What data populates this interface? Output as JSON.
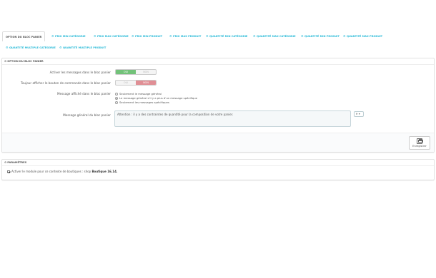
{
  "tabs": [
    {
      "label": "OPTION DU BLOC PANIER",
      "active": true
    },
    {
      "label": "PRIX MIN CATÉGORIE"
    },
    {
      "label": "PRIX MAX CATÉGORIE"
    },
    {
      "label": "PRIX MIN PRODUIT"
    },
    {
      "label": "PRIX MAX PRODUIT"
    },
    {
      "label": "QUANTITÉ MIN CATÉGORIE"
    },
    {
      "label": "QUANTITÉ MAX CATÉGORIE"
    },
    {
      "label": "QUANTITÉ MIN PRODUIT"
    },
    {
      "label": "QUANTITÉ MAX PRODUIT"
    },
    {
      "label": "QUANTITÉ MULTIPLE CATÉGORIE"
    },
    {
      "label": "QUANTITÉ MULTIPLE PRODUIT"
    }
  ],
  "panel_bloc": {
    "title": "OPTION DU BLOC PANIER",
    "field_messages": {
      "label": "Activer les messages dans le bloc panier",
      "yes": "OUI",
      "no": "NON",
      "value": "yes"
    },
    "field_order_button": {
      "label": "Toujour afficher le bouton de commande dans le bloc panier",
      "yes": "OUI",
      "no": "NON",
      "value": "no"
    },
    "field_message_type": {
      "label": "Message affiché dans le bloc panier",
      "options": [
        {
          "label": "Seulement le message général",
          "checked": false
        },
        {
          "label": "Le message général s'il y a plus d'un message spécifique",
          "checked": true
        },
        {
          "label": "Seulement les messages spécifiques",
          "checked": false
        }
      ]
    },
    "field_general_message": {
      "label": "Message général du bloc panier",
      "value": "Attention : il y a des contraintes de quantité pour la composition de votre panier.",
      "lang": "fr"
    },
    "save_label": "Enregistrer"
  },
  "panel_params": {
    "title": "PARAMÈTRES",
    "checkbox_label": "Activer le module pour ce contexte de boutiques : shop",
    "checkbox_value": "Boutique 16.14.",
    "checked": true
  }
}
